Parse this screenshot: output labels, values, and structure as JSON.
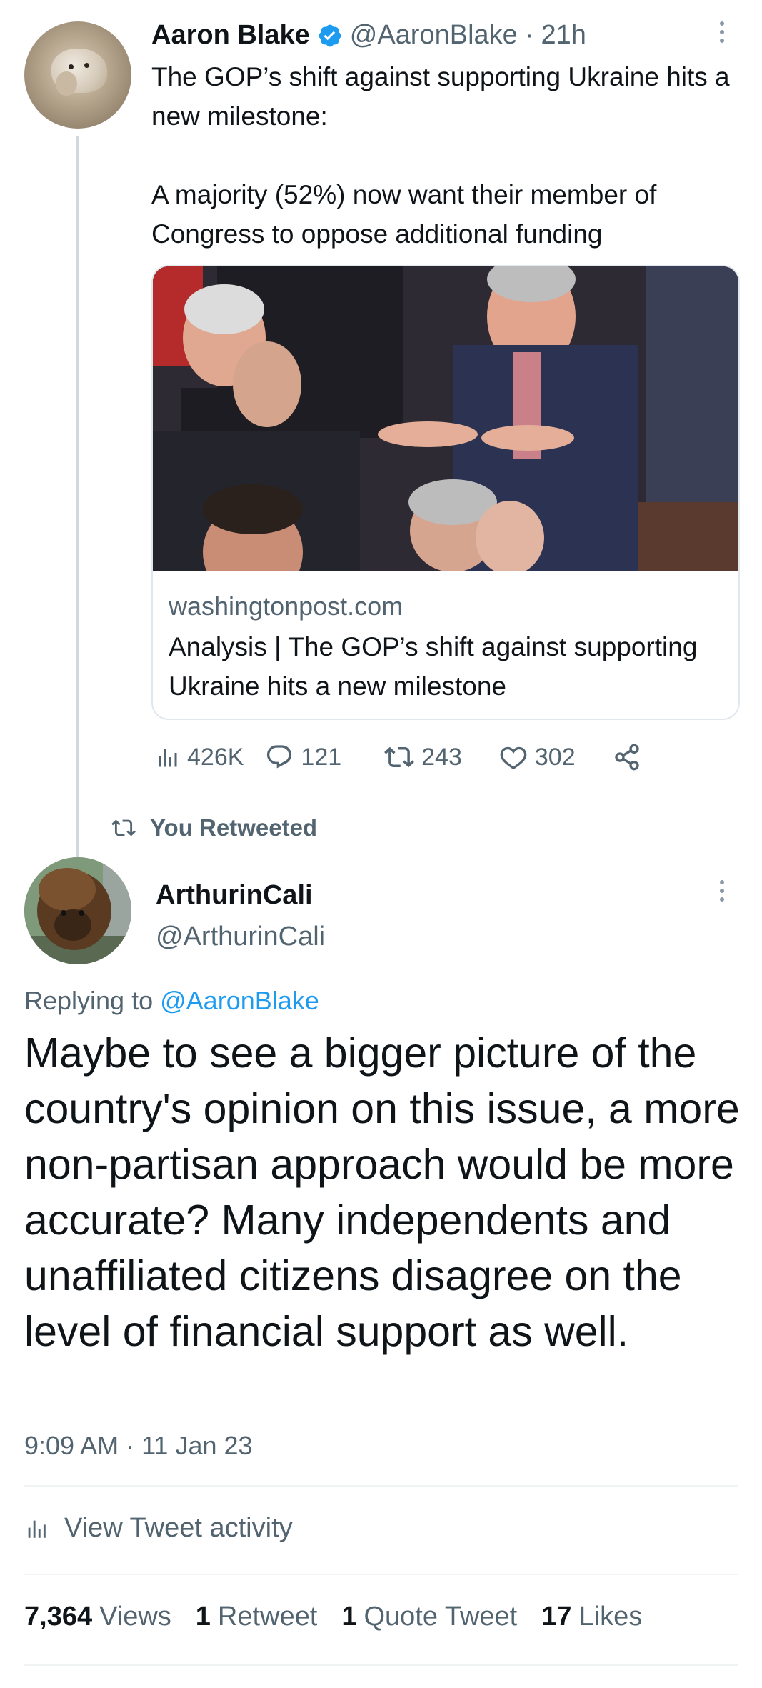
{
  "parent_tweet": {
    "author_name": "Aaron Blake",
    "handle": "@AaronBlake",
    "separator": "·",
    "time": "21h",
    "verified": true,
    "text": "The GOP’s shift against supporting Ukraine hits a new milestone:\n\nA majority (52%) now want their member of Congress to oppose additional funding",
    "card": {
      "domain": "washingtonpost.com",
      "title": "Analysis | The GOP’s shift against supporting Ukraine hits a new milestone"
    },
    "actions": {
      "views": "426K",
      "replies": "121",
      "retweets": "243",
      "likes": "302"
    }
  },
  "retweet_banner": {
    "label": "You Retweeted"
  },
  "reply_tweet": {
    "author_name": "ArthurinCali",
    "handle": "@ArthurinCali",
    "replying_prefix": "Replying to",
    "replying_to": "@AaronBlake",
    "text": "Maybe to see a bigger picture of the country's opinion on this issue, a more non-partisan approach would be more accurate? Many independents and unaffiliated citizens disagree on the level of financial support as well.",
    "timestamp": "9:09 AM · 11 Jan 23",
    "activity_label": "View Tweet activity",
    "stats": [
      {
        "value": "7,364",
        "label": "Views"
      },
      {
        "value": "1",
        "label": "Retweet"
      },
      {
        "value": "1",
        "label": "Quote Tweet"
      },
      {
        "value": "17",
        "label": "Likes"
      }
    ]
  },
  "colors": {
    "text_primary": "#0f1419",
    "text_secondary": "#536471",
    "link": "#1d9bf0",
    "verified_badge": "#1d9bf0",
    "divider": "#eff3f4"
  }
}
